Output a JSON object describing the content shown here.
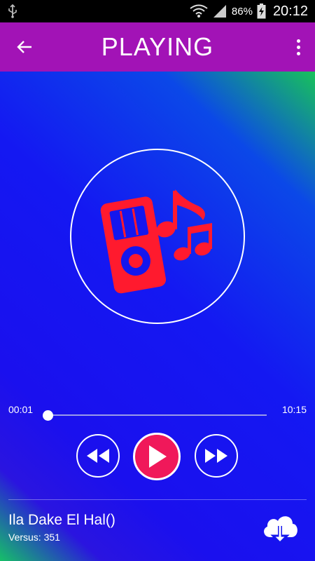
{
  "status_bar": {
    "battery_percent": "86%",
    "time": "20:12"
  },
  "app_bar": {
    "title": "PLAYING"
  },
  "player": {
    "current_time": "00:01",
    "total_time": "10:15",
    "progress": 0.0016
  },
  "song": {
    "title": "Ila Dake El Hal()",
    "subtitle": "Versus: 351"
  },
  "colors": {
    "app_bar": "#a213b6",
    "play_button": "#f0185a",
    "artwork_icon": "#ff1a2e"
  },
  "icons": {
    "back": "arrow-left-icon",
    "menu": "more-vert-icon",
    "rewind": "rewind-icon",
    "play": "play-icon",
    "forward": "fast-forward-icon",
    "download": "cloud-download-icon",
    "artwork": "music-player-icon"
  }
}
